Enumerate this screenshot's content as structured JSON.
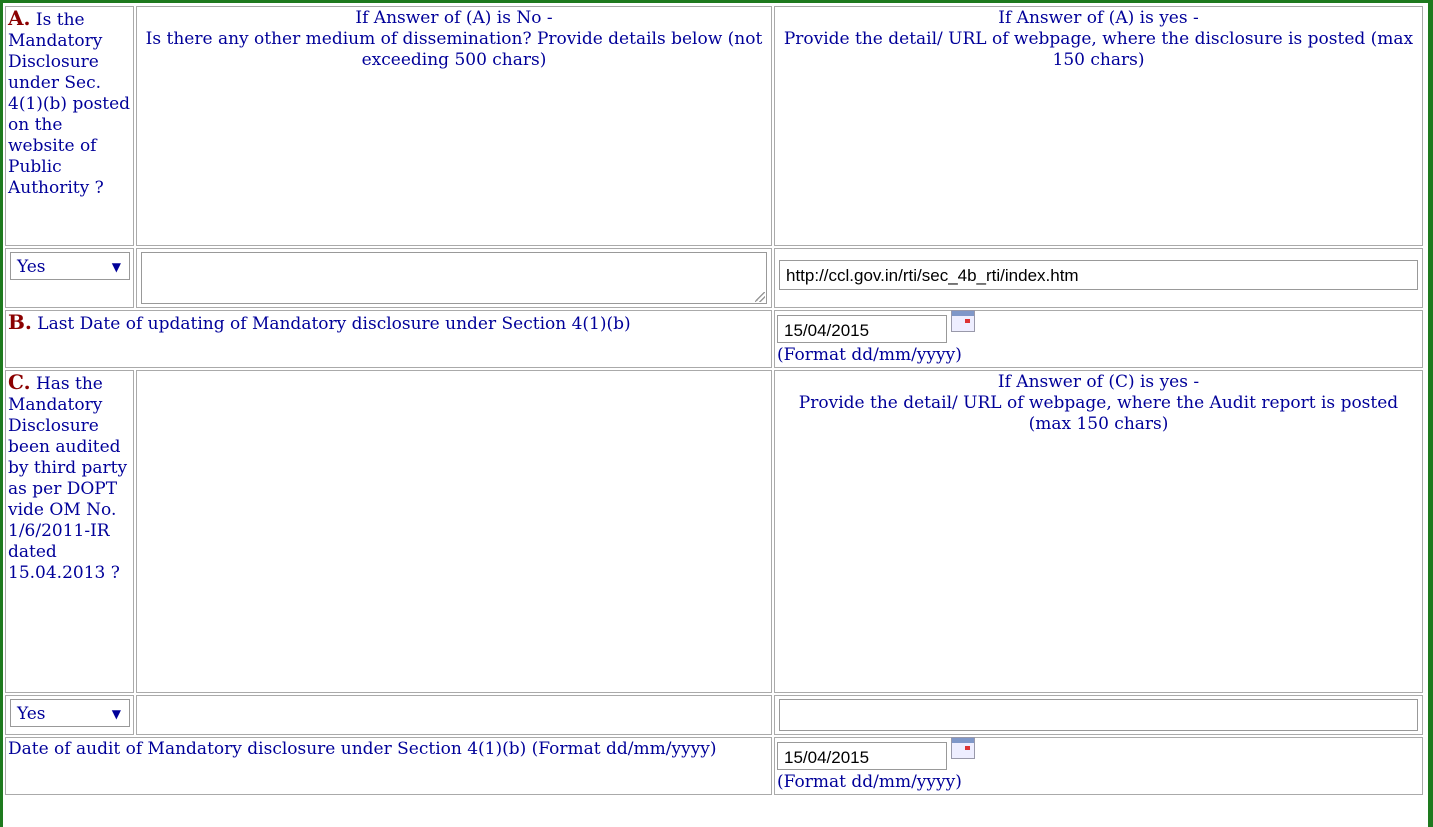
{
  "row_a": {
    "letter": "A.",
    "question": "Is the Mandatory Disclosure under Sec. 4(1)(b) posted on the website of Public Authority ?",
    "col2_line1": "If Answer of (A) is No -",
    "col2_line2": "Is there any other medium of dissemination? Provide details below (not exceeding 500 chars)",
    "col3_line1": "If Answer of (A) is yes -",
    "col3_line2": "Provide the detail/ URL of webpage, where the disclosure is posted (max 150 chars)",
    "select_value": "Yes",
    "other_medium_value": "",
    "url_value": "http://ccl.gov.in/rti/sec_4b_rti/index.htm"
  },
  "row_b": {
    "letter": "B.",
    "label": "Last Date of updating of Mandatory disclosure under Section 4(1)(b)",
    "date_value": "15/04/2015",
    "format_hint": "(Format dd/mm/yyyy)"
  },
  "row_c": {
    "letter": "C.",
    "question": "Has the Mandatory Disclosure been audited by third party as per DOPT vide OM No. 1/6/2011-IR dated 15.04.2013 ?",
    "col3_line1": "If Answer of (C) is yes -",
    "col3_line2": "Provide the detail/ URL of webpage, where the Audit report is posted (max 150 chars)",
    "select_value": "Yes",
    "audit_url_value": ""
  },
  "row_d": {
    "label": "Date of audit of Mandatory disclosure under Section 4(1)(b) (Format dd/mm/yyyy)",
    "date_value": "15/04/2015",
    "format_hint": "(Format dd/mm/yyyy)"
  },
  "icons": {
    "calendar": "calendar-icon",
    "dropdown": "chevron-down-icon",
    "resize": "resize-grip-icon"
  },
  "colors": {
    "border_green": "#1e7a1e",
    "text_blue": "#000099",
    "letter_red": "#8b0000"
  }
}
